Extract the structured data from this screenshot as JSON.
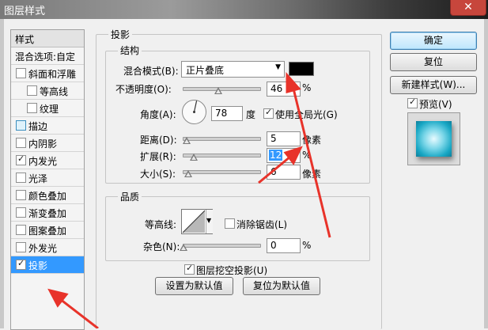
{
  "window": {
    "title": "图层样式",
    "close_glyph": "✕"
  },
  "styles_panel": {
    "header": "样式",
    "items": [
      {
        "label": "混合选项:自定",
        "checkbox": false,
        "checked": false
      },
      {
        "label": "斜面和浮雕",
        "checkbox": true,
        "checked": false
      },
      {
        "label": "等高线",
        "checkbox": true,
        "checked": false,
        "indent": true
      },
      {
        "label": "纹理",
        "checkbox": true,
        "checked": false,
        "indent": true
      },
      {
        "label": "描边",
        "checkbox": true,
        "checked": false
      },
      {
        "label": "内阴影",
        "checkbox": true,
        "checked": false
      },
      {
        "label": "内发光",
        "checkbox": true,
        "checked": true
      },
      {
        "label": "光泽",
        "checkbox": true,
        "checked": false
      },
      {
        "label": "颜色叠加",
        "checkbox": true,
        "checked": false
      },
      {
        "label": "渐变叠加",
        "checkbox": true,
        "checked": false
      },
      {
        "label": "图案叠加",
        "checkbox": true,
        "checked": false
      },
      {
        "label": "外发光",
        "checkbox": true,
        "checked": false
      },
      {
        "label": "投影",
        "checkbox": true,
        "checked": true,
        "selected": true
      }
    ]
  },
  "drop_shadow": {
    "group_title": "投影",
    "structure": {
      "title": "结构",
      "blend_mode_label": "混合模式(B):",
      "blend_mode_value": "正片叠底",
      "opacity_label": "不透明度(O):",
      "opacity_value": "46",
      "opacity_fraction": 0.46,
      "percent": "%",
      "angle_label": "角度(A):",
      "angle_value": "78",
      "angle_unit": "度",
      "global_light_label": "使用全局光(G)",
      "global_light_checked": true,
      "distance_label": "距离(D):",
      "distance_value": "5",
      "spread_label": "扩展(R):",
      "spread_value": "12",
      "size_label": "大小(S):",
      "size_value": "6",
      "pixel_unit": "像素"
    },
    "quality": {
      "title": "品质",
      "contour_label": "等高线:",
      "antialias_label": "消除锯齿(L)",
      "antialias_checked": false,
      "noise_label": "杂色(N):",
      "noise_value": "0",
      "percent": "%"
    },
    "knockout_label": "图层挖空投影(U)",
    "knockout_checked": true,
    "set_default_label": "设置为默认值",
    "reset_default_label": "复位为默认值"
  },
  "buttons": {
    "ok": "确定",
    "reset": "复位",
    "new_style": "新建样式(W)...",
    "preview_label": "预览(V)",
    "preview_checked": true
  },
  "colors": {
    "selection": "#3399ff",
    "shadow_color": "#000000",
    "annotation_arrow": "#e8332a"
  }
}
